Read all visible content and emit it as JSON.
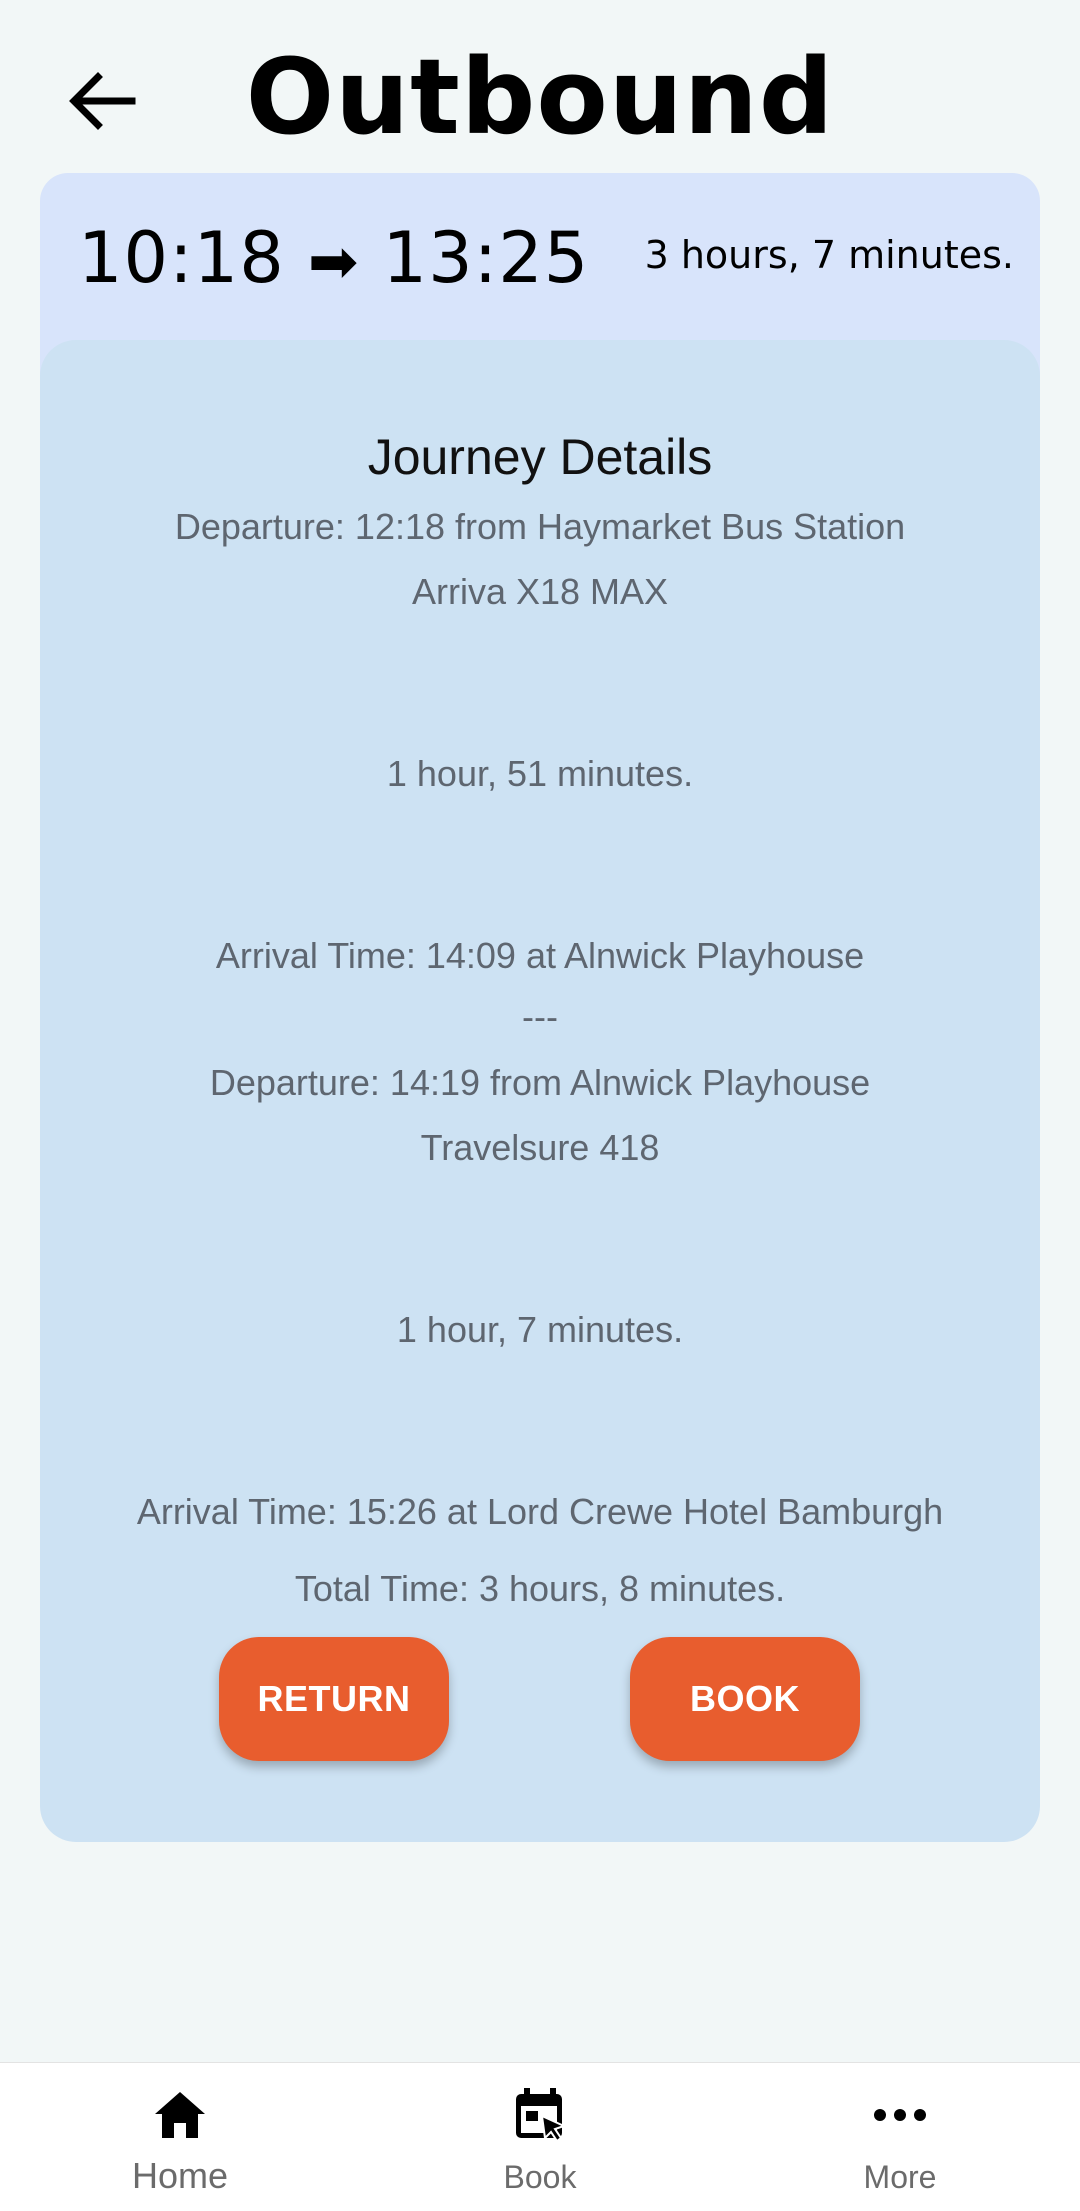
{
  "header": {
    "title": "Outbound",
    "back_icon": "arrow-left-icon"
  },
  "summary": {
    "depart": "10:18",
    "arrow": "➡",
    "arrive": "13:25",
    "duration": "3 hours, 7 minutes."
  },
  "details": {
    "title": "Journey Details",
    "legs": [
      {
        "departure": "Departure: 12:18 from Haymarket Bus Station",
        "service": "Arriva X18 MAX",
        "duration": "1 hour, 51 minutes.",
        "arrival": "Arrival Time: 14:09 at Alnwick Playhouse"
      },
      {
        "separator": "---",
        "departure": "Departure: 14:19 from Alnwick Playhouse",
        "service": "Travelsure 418",
        "duration": "1 hour, 7 minutes.",
        "arrival": "Arrival Time: 15:26 at Lord Crewe Hotel Bamburgh"
      }
    ],
    "total": "Total Time: 3 hours, 8 minutes.",
    "return_label": "RETURN",
    "book_label": "BOOK",
    "button_color": "#e85d2e"
  },
  "nav": {
    "items": [
      {
        "label": "Home",
        "icon": "home-icon"
      },
      {
        "label": "Book",
        "icon": "calendar-book-icon"
      },
      {
        "label": "More",
        "icon": "more-dots-icon"
      }
    ]
  }
}
